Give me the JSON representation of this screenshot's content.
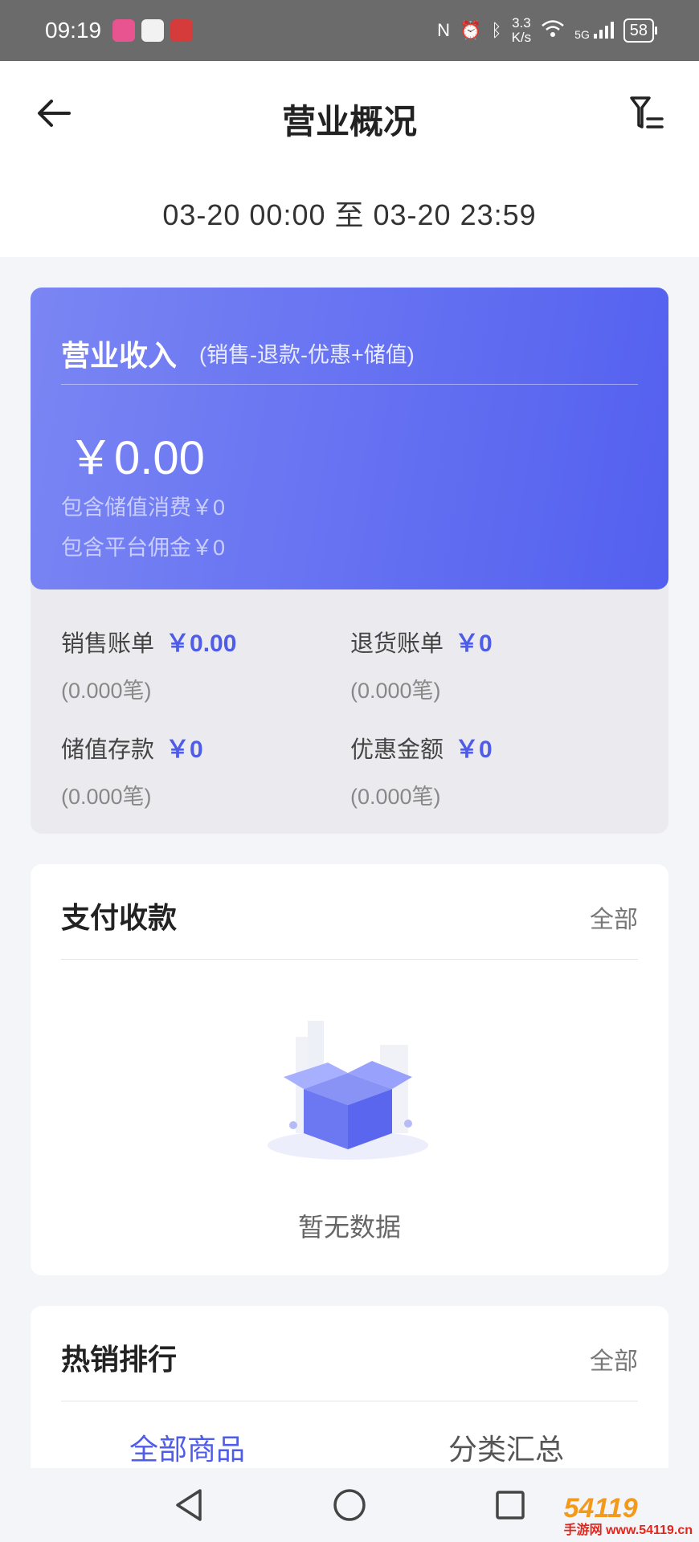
{
  "status_bar": {
    "time": "09:19",
    "app_icons": [
      "video-app-icon",
      "chat-app-icon",
      "bank-app-icon"
    ],
    "speed_value": "3.3",
    "speed_unit": "K/s",
    "network": "5G",
    "battery": "58"
  },
  "header": {
    "title": "营业概况",
    "date_range": "03-20 00:00 至 03-20 23:59"
  },
  "income": {
    "title": "营业收入",
    "formula": "(销售-退款-优惠+储值)",
    "amount": "￥0.00",
    "stored_value_consumption": "包含储值消费￥0",
    "platform_commission": "包含平台佣金￥0"
  },
  "stats": {
    "sales": {
      "label": "销售账单",
      "value": "￥0.00",
      "count": "(0.000笔)"
    },
    "returns": {
      "label": "退货账单",
      "value": "￥0",
      "count": "(0.000笔)"
    },
    "deposits": {
      "label": "储值存款",
      "value": "￥0",
      "count": "(0.000笔)"
    },
    "discounts": {
      "label": "优惠金额",
      "value": "￥0",
      "count": "(0.000笔)"
    }
  },
  "payment": {
    "title": "支付收款",
    "all_label": "全部",
    "empty_text": "暂无数据"
  },
  "hot_sales": {
    "title": "热销排行",
    "all_label": "全部",
    "tabs": [
      "全部商品",
      "分类汇总"
    ],
    "active_tab": "全部商品"
  },
  "watermark": {
    "text": "54119",
    "sub": "手游网 www.54119.cn"
  },
  "colors": {
    "accent": "#4f5ce8",
    "card_gradient_start": "#7b86f3",
    "card_gradient_end": "#5360ef",
    "status_bar": "#6b6b6b"
  }
}
